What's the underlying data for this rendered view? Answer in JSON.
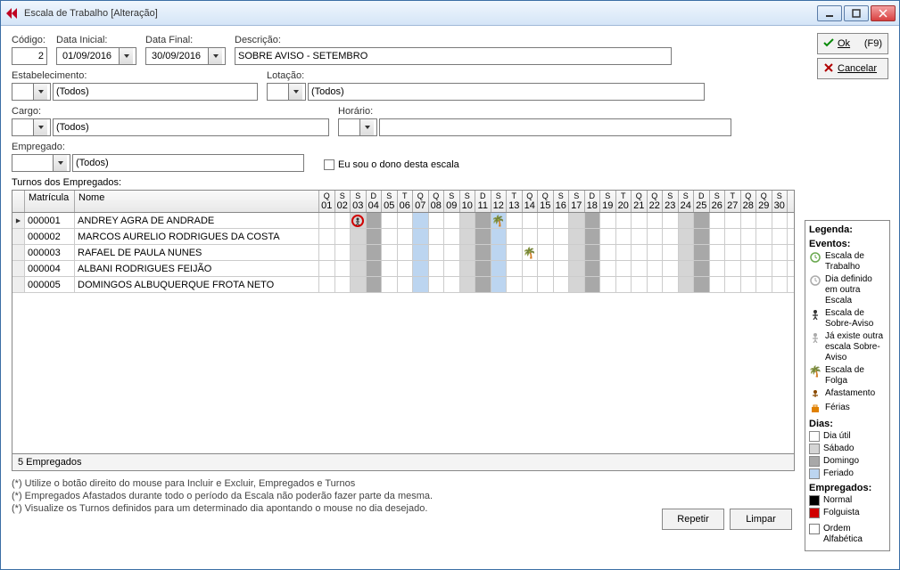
{
  "window": {
    "title": "Escala de Trabalho [Alteração]"
  },
  "buttons": {
    "ok": "Ok",
    "ok_shortcut": "(F9)",
    "cancel": "Cancelar",
    "repetir": "Repetir",
    "limpar": "Limpar"
  },
  "labels": {
    "codigo": "Código:",
    "data_inicial": "Data Inicial:",
    "data_final": "Data Final:",
    "descricao": "Descrição:",
    "estabelecimento": "Estabelecimento:",
    "lotacao": "Lotação:",
    "cargo": "Cargo:",
    "horario": "Horário:",
    "empregado": "Empregado:",
    "eu_dono": "Eu sou o dono desta escala",
    "turnos": "Turnos dos Empregados:",
    "matricula": "Matrícula",
    "nome": "Nome",
    "todos": "(Todos)"
  },
  "fields": {
    "codigo": "2",
    "data_inicial": "01/09/2016",
    "data_final": "30/09/2016",
    "descricao": "SOBRE AVISO - SETEMBRO",
    "estabelecimento": "(Todos)",
    "lotacao": "(Todos)",
    "cargo": "(Todos)",
    "horario": "",
    "empregado": "(Todos)"
  },
  "days": [
    {
      "n": "01",
      "w": "Q",
      "t": ""
    },
    {
      "n": "02",
      "w": "S",
      "t": ""
    },
    {
      "n": "03",
      "w": "S",
      "t": "sat"
    },
    {
      "n": "04",
      "w": "D",
      "t": "sun"
    },
    {
      "n": "05",
      "w": "S",
      "t": ""
    },
    {
      "n": "06",
      "w": "T",
      "t": ""
    },
    {
      "n": "07",
      "w": "Q",
      "t": "hol"
    },
    {
      "n": "08",
      "w": "Q",
      "t": ""
    },
    {
      "n": "09",
      "w": "S",
      "t": ""
    },
    {
      "n": "10",
      "w": "S",
      "t": "sat"
    },
    {
      "n": "11",
      "w": "D",
      "t": "sun"
    },
    {
      "n": "12",
      "w": "S",
      "t": "hol"
    },
    {
      "n": "13",
      "w": "T",
      "t": ""
    },
    {
      "n": "14",
      "w": "Q",
      "t": ""
    },
    {
      "n": "15",
      "w": "Q",
      "t": ""
    },
    {
      "n": "16",
      "w": "S",
      "t": ""
    },
    {
      "n": "17",
      "w": "S",
      "t": "sat"
    },
    {
      "n": "18",
      "w": "D",
      "t": "sun"
    },
    {
      "n": "19",
      "w": "S",
      "t": ""
    },
    {
      "n": "20",
      "w": "T",
      "t": ""
    },
    {
      "n": "21",
      "w": "Q",
      "t": ""
    },
    {
      "n": "22",
      "w": "Q",
      "t": ""
    },
    {
      "n": "23",
      "w": "S",
      "t": ""
    },
    {
      "n": "24",
      "w": "S",
      "t": "sat"
    },
    {
      "n": "25",
      "w": "D",
      "t": "sun"
    },
    {
      "n": "26",
      "w": "S",
      "t": ""
    },
    {
      "n": "27",
      "w": "T",
      "t": ""
    },
    {
      "n": "28",
      "w": "Q",
      "t": ""
    },
    {
      "n": "29",
      "w": "Q",
      "t": ""
    },
    {
      "n": "30",
      "w": "S",
      "t": ""
    }
  ],
  "rows": [
    {
      "mat": "000001",
      "nome": "ANDREY AGRA DE ANDRADE",
      "sel": true,
      "cells": {
        "03": "sobreaviso-circle",
        "12": "folga"
      }
    },
    {
      "mat": "000002",
      "nome": "MARCOS AURELIO RODRIGUES DA COSTA",
      "cells": {}
    },
    {
      "mat": "000003",
      "nome": "RAFAEL DE PAULA NUNES",
      "cells": {
        "14": "folga"
      }
    },
    {
      "mat": "000004",
      "nome": "ALBANI RODRIGUES FEIJÃO",
      "cells": {}
    },
    {
      "mat": "000005",
      "nome": "DOMINGOS ALBUQUERQUE FROTA NETO",
      "cells": {}
    }
  ],
  "status": "5 Empregados",
  "hints": [
    "(*) Utilize o botão direito do mouse para Incluir e Excluir, Empregados e Turnos",
    "(*) Empregados Afastados durante todo o período da Escala não poderão fazer parte da mesma.",
    "(*) Visualize os Turnos definidos para um determinado dia apontando o mouse no dia desejado."
  ],
  "legend": {
    "title": "Legenda:",
    "eventos": "Eventos:",
    "ev": [
      {
        "icon": "clock",
        "txt": "Escala de Trabalho"
      },
      {
        "icon": "clock-gray",
        "txt": "Dia definido em outra Escala"
      },
      {
        "icon": "person",
        "txt": "Escala de Sobre-Aviso"
      },
      {
        "icon": "person-gray",
        "txt": "Já existe outra escala Sobre-Aviso"
      },
      {
        "icon": "palm",
        "txt": "Escala de Folga"
      },
      {
        "icon": "afast",
        "txt": "Afastamento"
      },
      {
        "icon": "suitcase",
        "txt": "Férias"
      }
    ],
    "dias": "Dias:",
    "di": [
      {
        "sw": "white",
        "txt": "Dia útil"
      },
      {
        "sw": "lgray",
        "txt": "Sábado"
      },
      {
        "sw": "dgray",
        "txt": "Domingo"
      },
      {
        "sw": "blue",
        "txt": "Feriado"
      }
    ],
    "emp": "Empregados:",
    "em": [
      {
        "sw": "black",
        "txt": "Normal"
      },
      {
        "sw": "red",
        "txt": "Folguista"
      }
    ],
    "ordem": "Ordem Alfabética"
  }
}
